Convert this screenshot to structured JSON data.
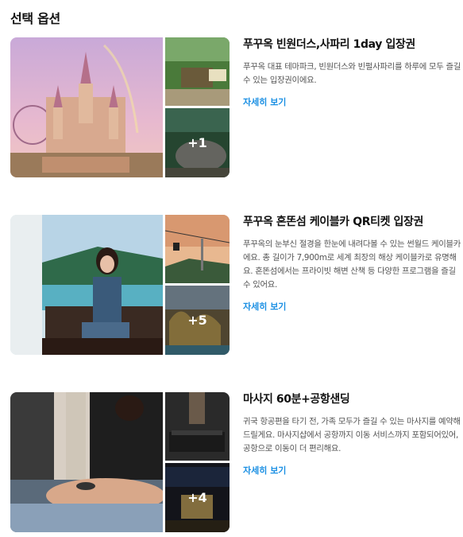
{
  "section": {
    "title": "선택 옵션"
  },
  "options": [
    {
      "title": "푸꾸옥 빈원더스,사파리 1day 입장권",
      "description": "푸꾸옥 대표 테마파크, 빈원더스와 빈펄사파리를 하루에 모두 즐길 수 있는 입장권이에요.",
      "more_label": "자세히 보기",
      "extra_photos": "+1"
    },
    {
      "title": "푸꾸옥 혼똔섬 케이블카 QR티켓 입장권",
      "description": "푸꾸옥의 눈부신 절경을 한눈에 내려다볼 수 있는 썬월드 케이블카에요. 총 길이가 7,900m로 세계 최장의 해상 케이블카로 유명해요. 혼똔섬에서는 프라이빗 해변 산책 등 다양한 프로그램을 즐길 수 있어요.",
      "more_label": "자세히 보기",
      "extra_photos": "+5"
    },
    {
      "title": "마사지 60분+공항샌딩",
      "description": "귀국 항공편을 타기 전, 가족 모두가 즐길 수 있는 마사지를 예약해드릴게요. 마사지샵에서 공항까지 이동 서비스까지 포함되어있어, 공항으로 이동이 더 편리해요.",
      "more_label": "자세히 보기",
      "extra_photos": "+4"
    }
  ],
  "colors": {
    "link": "#1a8fe3",
    "title": "#111111",
    "description": "#555555"
  }
}
